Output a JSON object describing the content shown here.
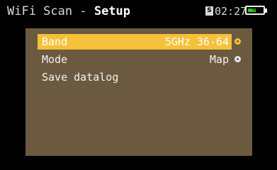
{
  "header": {
    "app_name": "WiFi Scan",
    "separator": " - ",
    "screen_name": "Setup",
    "sd_label": "S",
    "time": "02:27",
    "battery_level": 0.55,
    "battery_color": "#2fc51f"
  },
  "menu": {
    "items": [
      {
        "label": "Band",
        "value": "5GHz 36-64",
        "selected": true
      },
      {
        "label": "Mode",
        "value": "Map",
        "selected": false
      },
      {
        "label": "Save datalog",
        "value": "",
        "selected": false
      }
    ]
  },
  "colors": {
    "panel_bg": "#6b5a40",
    "highlight": "#f5c13a",
    "screen_bg": "#000000"
  }
}
